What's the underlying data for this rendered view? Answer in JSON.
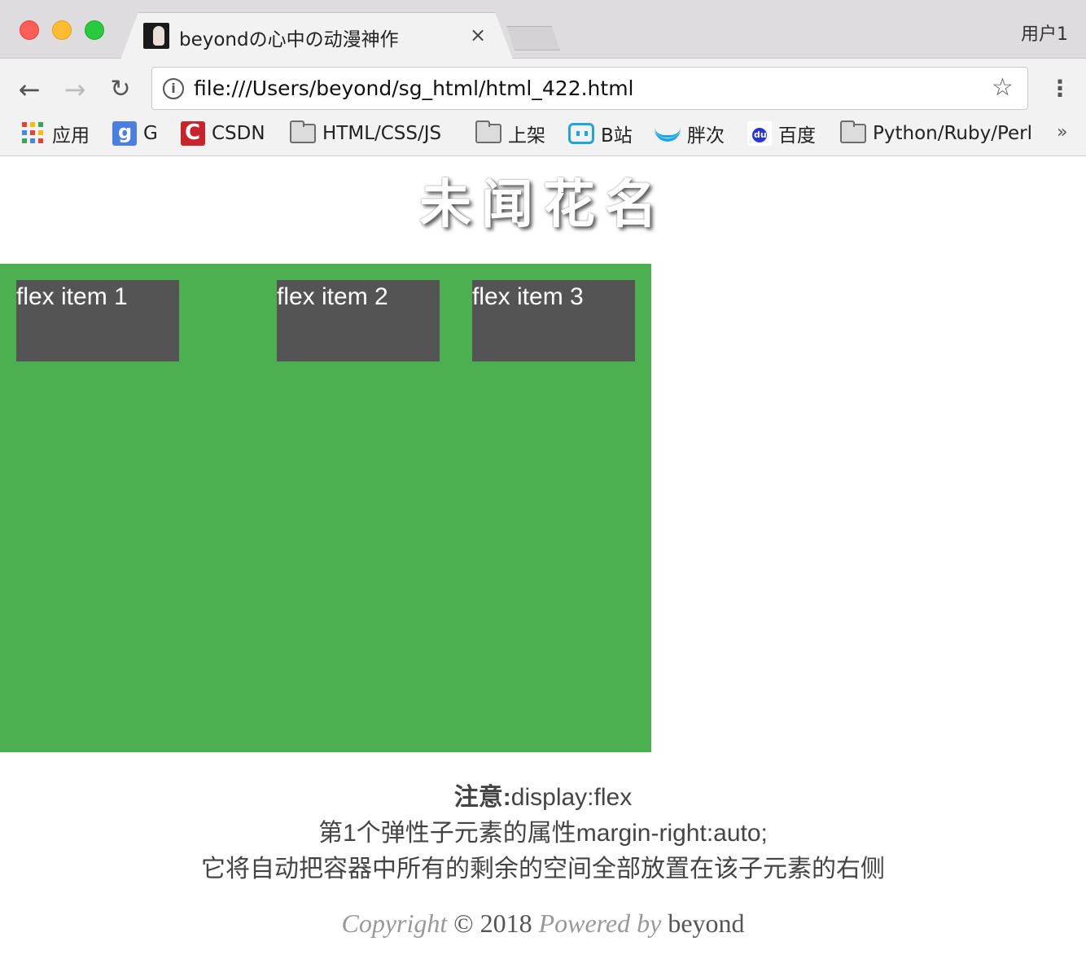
{
  "browser": {
    "tab_title": "beyondの心中の动漫神作",
    "tab_close": "×",
    "user_label": "用户1",
    "nav": {
      "back": "←",
      "forward": "→",
      "reload": "↻"
    },
    "info_icon": "i",
    "url": "file:///Users/beyond/sg_html/html_422.html",
    "star": "☆",
    "menu": "⋮",
    "bookmarks": [
      {
        "label": "应用",
        "icon": "apps-icon"
      },
      {
        "label": "G",
        "icon": "g-icon"
      },
      {
        "label": "CSDN",
        "icon": "csdn-icon"
      },
      {
        "label": "HTML/CSS/JS",
        "icon": "folder-icon"
      },
      {
        "label": "上架",
        "icon": "folder-icon"
      },
      {
        "label": "B站",
        "icon": "bilibili-icon"
      },
      {
        "label": "胖次",
        "icon": "pangci-icon"
      },
      {
        "label": "百度",
        "icon": "baidu-icon"
      },
      {
        "label": "Python/Ruby/Perl",
        "icon": "folder-icon"
      }
    ],
    "bookmarks_more": "»"
  },
  "page": {
    "title": "未闻花名",
    "container_color": "#4caf50",
    "item_color": "#545454",
    "items": [
      "flex item 1",
      "flex item 2",
      "flex item 3"
    ],
    "note": {
      "label": "注意:",
      "line1_rest": "display:flex",
      "line2": "第1个弹性子元素的属性margin-right:auto;",
      "line3": "它将自动把容器中所有的剩余的空间全部放置在该子元素的右侧"
    },
    "footer": {
      "copyright": "Copyright",
      "symbol": "©",
      "year": "2018",
      "powered": "Powered by",
      "author": "beyond"
    }
  }
}
